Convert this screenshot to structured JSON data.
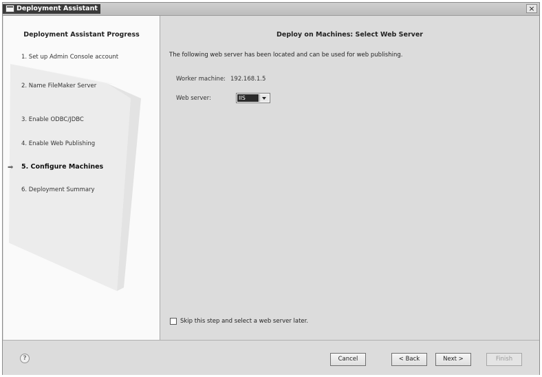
{
  "window": {
    "title": "Deployment Assistant",
    "close_symbol": "×"
  },
  "sidebar": {
    "title": "Deployment Assistant Progress",
    "steps": [
      {
        "label": "1. Set up Admin Console account"
      },
      {
        "label": "2. Name FileMaker Server"
      },
      {
        "label": "3. Enable ODBC/JDBC"
      },
      {
        "label": "4. Enable Web Publishing"
      },
      {
        "label": "5. Configure Machines",
        "current": true
      },
      {
        "label": "6. Deployment Summary"
      }
    ],
    "current_marker": "➡"
  },
  "main": {
    "title": "Deploy on Machines: Select Web Server",
    "intro": "The following web server has been located and can be used for web publishing.",
    "worker_label": "Worker machine:",
    "worker_value": "192.168.1.5",
    "web_server_label": "Web server:",
    "web_server_value": "IIS",
    "skip_label": "Skip this step and select a web server later.",
    "skip_checked": false
  },
  "footer": {
    "help_symbol": "?",
    "cancel": "Cancel",
    "back": "< Back",
    "next": "Next >",
    "finish": "Finish"
  }
}
